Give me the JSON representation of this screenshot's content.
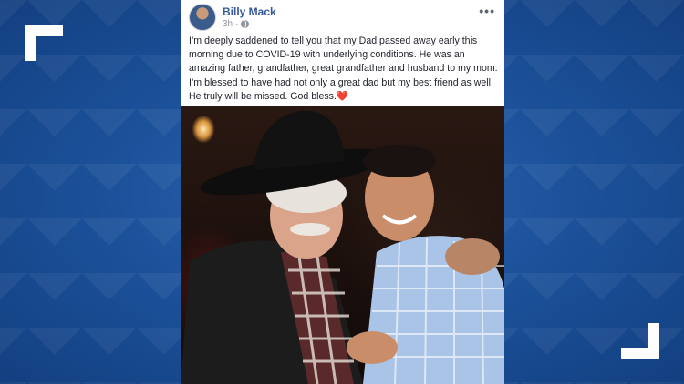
{
  "post": {
    "author": "Billy Mack",
    "time": "3h",
    "more_icon": "more-options-icon",
    "text": "I’m deeply saddened to tell you that my Dad passed away early this morning due to COVID-19 with underlying conditions. He was an amazing father, grandfather, great grandfather and husband to my mom. I’m blessed to have had not only a great dad but my best friend as well. He truly will be missed. God bless.",
    "emoji": "❤️"
  },
  "colors": {
    "background": "#1a4f97",
    "author_link": "#385898",
    "heart": "#e0245e"
  }
}
